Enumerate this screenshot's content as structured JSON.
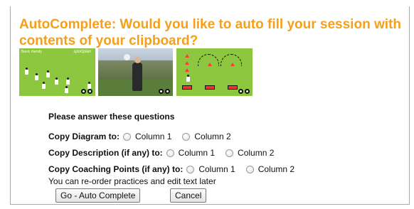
{
  "dialog": {
    "title": "AutoComplete: Would you like to auto fill your session with contents of your clipboard?",
    "thumbnails": [
      {
        "icon": "diagram-thumbnail",
        "caption": "Basic rhendy",
        "logo": "sportplan"
      },
      {
        "icon": "photo-thumbnail"
      },
      {
        "icon": "diagram-thumbnail-2"
      }
    ],
    "form": {
      "heading": "Please answer these questions",
      "questions": [
        {
          "label": "Copy Diagram to:",
          "options": [
            "Column 1",
            "Column 2"
          ]
        },
        {
          "label": "Copy Description (if any) to:",
          "options": [
            "Column 1",
            "Column 2"
          ]
        },
        {
          "label": "Copy Coaching Points (if any) to:",
          "options": [
            "Column 1",
            "Column 2"
          ]
        }
      ],
      "note": "You can re-order practices and edit text later"
    },
    "buttons": {
      "auto_complete": "Go - Auto Complete",
      "cancel": "Cancel"
    }
  },
  "colors": {
    "title": "#f5a01a",
    "diagram_background": "#8dc63f"
  }
}
